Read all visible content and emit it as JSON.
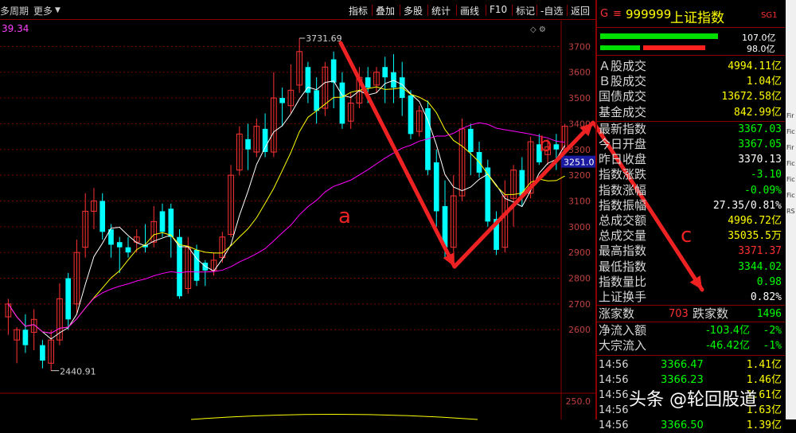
{
  "topbar": {
    "period": "多周期",
    "more": "更多",
    "buttons": [
      "指标",
      "叠加",
      "多股",
      "统计",
      "画线",
      "F10",
      "标记",
      "-自选",
      "返回"
    ]
  },
  "indicator_value": "39.34",
  "chart_data": {
    "type": "candlestick",
    "ylim": [
      2440,
      3800
    ],
    "yticks": [
      2600,
      2700,
      2800,
      2900,
      3000,
      3100,
      3200,
      3300,
      3400,
      3500,
      3600,
      3700
    ],
    "high_label": "3731.69",
    "low_label": "2440.91",
    "price_tag": "3251.0",
    "vol_tick": "250.0",
    "candles": [
      [
        2650,
        2700,
        2580,
        2720
      ],
      [
        2560,
        2600,
        2470,
        2610
      ],
      [
        2600,
        2540,
        2510,
        2660
      ],
      [
        2590,
        2640,
        2520,
        2680
      ],
      [
        2540,
        2480,
        2450,
        2560
      ],
      [
        2470,
        2560,
        2440,
        2600
      ],
      [
        2560,
        2720,
        2540,
        2780
      ],
      [
        2800,
        2640,
        2600,
        2820
      ],
      [
        2700,
        2900,
        2660,
        2950
      ],
      [
        2920,
        3060,
        2880,
        3130
      ],
      [
        3060,
        3100,
        2990,
        3150
      ],
      [
        3100,
        2980,
        2950,
        3130
      ],
      [
        2990,
        2930,
        2880,
        3010
      ],
      [
        2940,
        2920,
        2820,
        2960
      ],
      [
        2920,
        2900,
        2880,
        2960
      ],
      [
        2940,
        2960,
        2900,
        2990
      ],
      [
        2930,
        2920,
        2900,
        3010
      ],
      [
        2940,
        3020,
        2920,
        3080
      ],
      [
        3060,
        2980,
        2960,
        3090
      ],
      [
        3070,
        2960,
        2880,
        3090
      ],
      [
        2960,
        2730,
        2720,
        2990
      ],
      [
        2760,
        2920,
        2740,
        2960
      ],
      [
        2910,
        2790,
        2770,
        2930
      ],
      [
        2860,
        2830,
        2770,
        2870
      ],
      [
        2830,
        2870,
        2810,
        2900
      ],
      [
        2880,
        2960,
        2860,
        2980
      ],
      [
        2970,
        3200,
        2960,
        3240
      ],
      [
        3220,
        3360,
        3200,
        3390
      ],
      [
        3340,
        3300,
        3220,
        3400
      ],
      [
        3290,
        3390,
        3270,
        3420
      ],
      [
        3380,
        3290,
        3270,
        3440
      ],
      [
        3290,
        3500,
        3270,
        3600
      ],
      [
        3500,
        3480,
        3390,
        3540
      ],
      [
        3470,
        3530,
        3440,
        3630
      ],
      [
        3550,
        3680,
        3520,
        3732
      ],
      [
        3620,
        3520,
        3480,
        3640
      ],
      [
        3530,
        3450,
        3400,
        3580
      ],
      [
        3460,
        3620,
        3430,
        3640
      ],
      [
        3650,
        3560,
        3460,
        3680
      ],
      [
        3560,
        3400,
        3380,
        3600
      ],
      [
        3410,
        3480,
        3380,
        3520
      ],
      [
        3480,
        3580,
        3460,
        3620
      ],
      [
        3580,
        3540,
        3480,
        3620
      ],
      [
        3550,
        3600,
        3520,
        3620
      ],
      [
        3620,
        3580,
        3480,
        3660
      ],
      [
        3600,
        3540,
        3480,
        3670
      ],
      [
        3580,
        3500,
        3430,
        3640
      ],
      [
        3510,
        3360,
        3340,
        3530
      ],
      [
        3370,
        3450,
        3350,
        3470
      ],
      [
        3460,
        3220,
        3200,
        3490
      ],
      [
        3250,
        3060,
        3000,
        3300
      ],
      [
        3080,
        2920,
        2880,
        3180
      ],
      [
        2920,
        3120,
        2900,
        3200
      ],
      [
        3120,
        3380,
        3100,
        3420
      ],
      [
        3380,
        3290,
        3200,
        3400
      ],
      [
        3290,
        3210,
        3190,
        3330
      ],
      [
        3230,
        3020,
        3000,
        3260
      ],
      [
        3030,
        2910,
        2890,
        3060
      ],
      [
        2920,
        3120,
        2900,
        3180
      ],
      [
        3110,
        3220,
        3000,
        3240
      ],
      [
        3220,
        3120,
        3080,
        3270
      ],
      [
        3130,
        3330,
        3110,
        3350
      ],
      [
        3320,
        3250,
        3240,
        3360
      ],
      [
        3280,
        3310,
        3240,
        3340
      ],
      [
        3320,
        3300,
        3220,
        3360
      ],
      [
        3300,
        3390,
        3290,
        3400
      ]
    ],
    "annotations": {
      "a": "a",
      "b": "b",
      "c": "c"
    }
  },
  "quote": {
    "flag": "G",
    "menu": "≡",
    "code": "999999",
    "name": "上证指数",
    "tag": "SG1",
    "bar1_val": "107.0亿",
    "bar2_val": "98.0亿",
    "rows": [
      {
        "label": "Ａ股成交",
        "value": "4994.11亿",
        "c": "yl"
      },
      {
        "label": "Ｂ股成交",
        "value": "1.04亿",
        "c": "yl"
      },
      {
        "label": "国债成交",
        "value": "13672.58亿",
        "c": "yl"
      },
      {
        "label": "基金成交",
        "value": "842.99亿",
        "c": "yl"
      },
      {
        "label": "最新指数",
        "value": "3367.03",
        "c": "gr"
      },
      {
        "label": "今日开盘",
        "value": "3367.05",
        "c": "gr"
      },
      {
        "label": "昨日收盘",
        "value": "3370.13",
        "c": "wh"
      },
      {
        "label": "指数涨跌",
        "value": "-3.10",
        "c": "gr"
      },
      {
        "label": "指数涨幅",
        "value": "-0.09%",
        "c": "gr"
      },
      {
        "label": "指数振幅",
        "value": "27.35/0.81%",
        "c": "wh"
      },
      {
        "label": "总成交额",
        "value": "4996.72亿",
        "c": "yl"
      },
      {
        "label": "总成交量",
        "value": "35035.5万",
        "c": "yl"
      },
      {
        "label": "最高指数",
        "value": "3371.37",
        "c": "rd"
      },
      {
        "label": "最低指数",
        "value": "3344.02",
        "c": "gr"
      },
      {
        "label": "指数量比",
        "value": "0.98",
        "c": "gr"
      },
      {
        "label": "上证换手",
        "value": "0.82%",
        "c": "wh"
      }
    ],
    "up_label": "涨家数",
    "up_count": "703",
    "down_label": "跌家数",
    "down_count": "1496",
    "flow": [
      {
        "label": "净流入额",
        "value": "-103.4亿",
        "pct": "-2%"
      },
      {
        "label": "大宗流入",
        "value": "-46.42亿",
        "pct": "-1%"
      }
    ],
    "ticks": [
      {
        "time": "14:56",
        "price": "3366.47",
        "vol": "1.41亿"
      },
      {
        "time": "14:56",
        "price": "3366.23",
        "vol": "1.46亿"
      },
      {
        "time": "14:56",
        "price": "",
        "vol": "1.61亿"
      },
      {
        "time": "14:56",
        "price": "",
        "vol": "1.63亿"
      },
      {
        "time": "14:56",
        "price": "3366.50",
        "vol": "1.39亿"
      }
    ]
  },
  "watermark": "头条 @轮回股道",
  "strip_labels": [
    "",
    "",
    "",
    "Fir",
    "Fic",
    "Fir",
    "Fic",
    "Fic",
    "Fic",
    "RS"
  ]
}
